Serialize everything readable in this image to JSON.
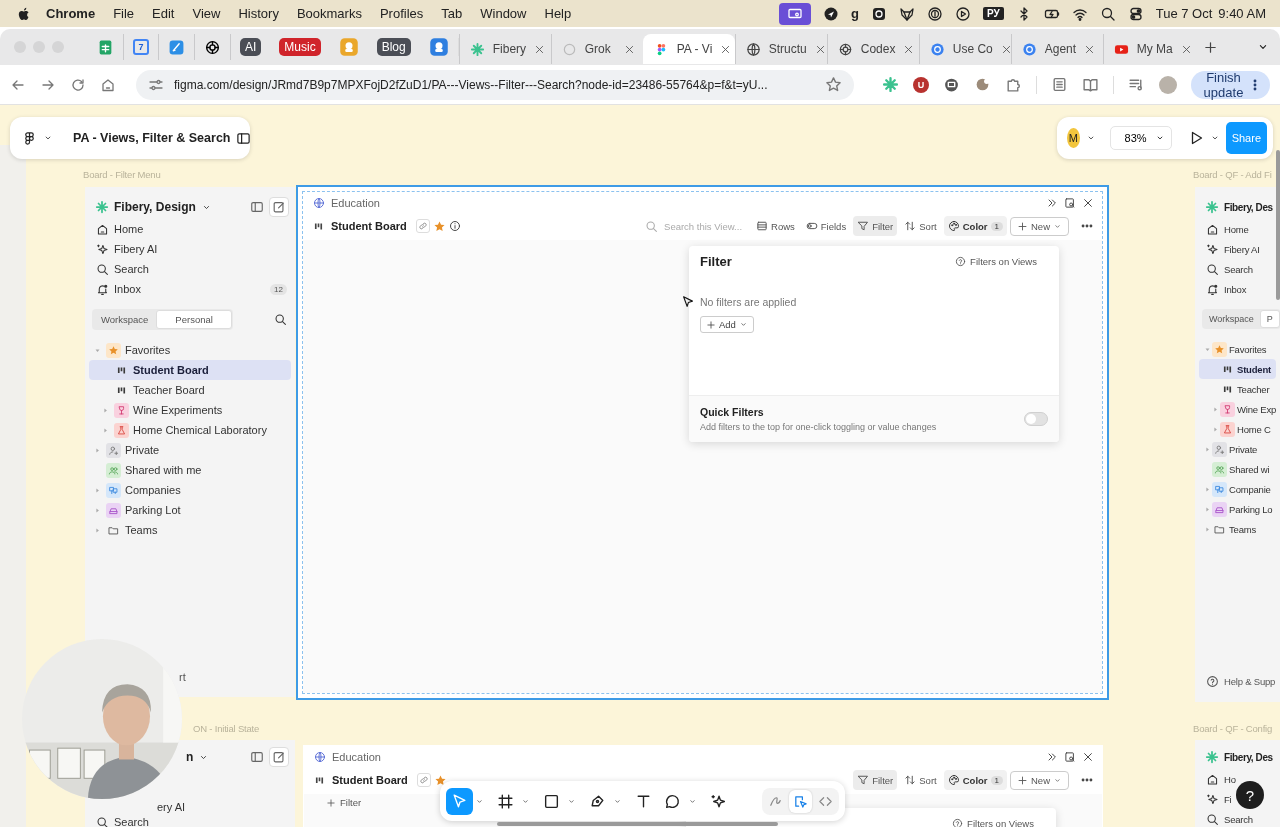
{
  "menubar": {
    "app": "Chrome",
    "menus": [
      "File",
      "Edit",
      "View",
      "History",
      "Bookmarks",
      "Profiles",
      "Tab",
      "Window",
      "Help"
    ],
    "status": [
      {
        "kind": "screen"
      },
      {
        "kind": "navigate"
      },
      {
        "kind": "letter",
        "label": "g"
      },
      {
        "kind": "gear"
      },
      {
        "kind": "fox"
      },
      {
        "kind": "key"
      },
      {
        "kind": "play"
      },
      {
        "kind": "letter",
        "label": "РУ"
      },
      {
        "kind": "bluetooth"
      },
      {
        "kind": "battery"
      },
      {
        "kind": "wifi"
      },
      {
        "kind": "search"
      },
      {
        "kind": "control"
      }
    ],
    "date": "Tue 7 Oct",
    "time": "9:40 AM"
  },
  "browser": {
    "pinned": [
      {
        "kind": "sheets"
      },
      {
        "kind": "calendar",
        "label": "7"
      },
      {
        "kind": "pen"
      },
      {
        "kind": "openai"
      },
      {
        "kind": "badge",
        "label": "AI",
        "color": "#4b4e56"
      },
      {
        "kind": "badge",
        "label": "Music",
        "color": "#d0242b"
      },
      {
        "kind": "app",
        "color": "#eaa72b"
      },
      {
        "kind": "badge",
        "label": "Blog",
        "color": "#4b4e56"
      },
      {
        "kind": "app",
        "color": "#2f7fe0"
      }
    ],
    "tabs": [
      {
        "kind": "fibery",
        "title": "Fibery",
        "selected": false
      },
      {
        "kind": "grok",
        "title": "Grok",
        "selected": false
      },
      {
        "kind": "figma",
        "title": "PA - Vi",
        "selected": true
      },
      {
        "kind": "globe",
        "title": "Structu",
        "selected": false
      },
      {
        "kind": "openai",
        "title": "Codex",
        "selected": false
      },
      {
        "kind": "blue",
        "title": "Use Co",
        "selected": false
      },
      {
        "kind": "blue",
        "title": "Agent",
        "selected": false
      },
      {
        "kind": "youtube",
        "title": "My Ma",
        "selected": false
      }
    ],
    "url": "figma.com/design/JRmd7B9p7MPXFojD2fZuD1/PA---Views--Filter---Search?node-id=23486-55764&p=f&t=yU...",
    "extensions": [
      {
        "kind": "fibery"
      },
      {
        "kind": "letter",
        "label": "U"
      },
      {
        "kind": "cat"
      },
      {
        "kind": "cookie"
      },
      {
        "kind": "puzzle"
      }
    ],
    "update_button": "Finish update"
  },
  "figma": {
    "file_name": "PA - Views, Filter & Search",
    "avatar": "M",
    "zoom": "83%",
    "share": "Share",
    "frames": [
      {
        "label": "Board - Filter Menu",
        "sidebar": {
          "workspace": {
            "kind": "full",
            "label": "Fibery, Design"
          },
          "nav": [
            {
              "kind": "home",
              "label": "Home"
            },
            {
              "kind": "ai",
              "label": "Fibery AI"
            },
            {
              "kind": "search",
              "label": "Search"
            },
            {
              "kind": "inbox",
              "label": "Inbox",
              "badge": "12"
            }
          ],
          "scope_tabs": [
            {
              "label": "Workspace",
              "selected": false
            },
            {
              "label": "Personal",
              "selected": true
            }
          ],
          "tree": [
            {
              "kind": "favorites",
              "label": "Favorites",
              "expanded": true,
              "selected": false,
              "children": [
                {
                  "kind": "board",
                  "label": "Student Board",
                  "selected": true
                },
                {
                  "kind": "board",
                  "label": "Teacher Board",
                  "selected": false
                },
                {
                  "kind": "wine",
                  "label": "Wine Experiments",
                  "expanded": false,
                  "selected": false
                },
                {
                  "kind": "lab",
                  "label": "Home Chemical Laboratory",
                  "expanded": false,
                  "selected": false
                }
              ]
            },
            {
              "kind": "private",
              "label": "Private",
              "expanded": false,
              "selected": false
            },
            {
              "kind": "shared",
              "label": "Shared with me",
              "selected": false
            },
            {
              "kind": "companies",
              "label": "Companies",
              "expanded": false,
              "selected": false
            },
            {
              "kind": "parking",
              "label": "Parking Lot",
              "expanded": false,
              "selected": false
            },
            {
              "kind": "folder",
              "label": "Teams",
              "expanded": false,
              "selected": false
            }
          ],
          "help": {
            "kind": "cut",
            "label": "rt"
          }
        },
        "view": {
          "selected": true,
          "space": "Education",
          "title": "Student Board",
          "favorite": true,
          "toolbar": [
            {
              "kind": "search",
              "placeholder": "Search this View..."
            },
            {
              "kind": "rows",
              "label": "Rows",
              "selected": false
            },
            {
              "kind": "fields",
              "label": "Fields",
              "selected": false
            },
            {
              "kind": "filter",
              "label": "Filter",
              "selected": true
            },
            {
              "kind": "sort",
              "label": "Sort",
              "selected": false
            },
            {
              "kind": "color",
              "label": "Color",
              "badge": "1"
            },
            {
              "kind": "new",
              "label": "New"
            },
            {
              "kind": "more"
            }
          ],
          "panel": {
            "title": "Filter",
            "help": "Filters on Views",
            "empty": "No filters are applied",
            "add": "Add",
            "quick_title": "Quick Filters",
            "quick_desc": "Add filters to the top for one-click toggling or value changes",
            "quick_on": false
          }
        }
      },
      {
        "label": "Board - QF - Add Fi",
        "sidebar": {
          "workspace": {
            "kind": "full",
            "label": "Fibery, Des"
          },
          "nav": [
            {
              "kind": "home",
              "label": "Home"
            },
            {
              "kind": "ai",
              "label": "Fibery AI"
            },
            {
              "kind": "search",
              "label": "Search"
            },
            {
              "kind": "inbox",
              "label": "Inbox"
            }
          ],
          "scope_tabs": [
            {
              "label": "Workspace",
              "selected": false
            },
            {
              "label": "P",
              "selected": true
            }
          ],
          "tree": [
            {
              "kind": "favorites",
              "label": "Favorites",
              "expanded": true,
              "selected": false,
              "children": [
                {
                  "kind": "board",
                  "label": "Student",
                  "selected": true
                },
                {
                  "kind": "board",
                  "label": "Teacher",
                  "selected": false
                },
                {
                  "kind": "wine",
                  "label": "Wine Exp",
                  "expanded": false,
                  "selected": false
                },
                {
                  "kind": "lab",
                  "label": "Home C",
                  "expanded": false,
                  "selected": false
                }
              ]
            },
            {
              "kind": "private",
              "label": "Private",
              "expanded": false,
              "selected": false
            },
            {
              "kind": "shared",
              "label": "Shared wi",
              "selected": false
            },
            {
              "kind": "companies",
              "label": "Companie",
              "expanded": false,
              "selected": false
            },
            {
              "kind": "parking",
              "label": "Parking Lo",
              "expanded": false,
              "selected": false
            },
            {
              "kind": "folder",
              "label": "Teams",
              "expanded": false,
              "selected": false
            }
          ],
          "help": {
            "kind": "help",
            "label": "Help & Supp"
          }
        }
      },
      {
        "label": "ON - Initial State",
        "sidebar": {
          "workspace": {
            "kind": "cut",
            "label": "n"
          },
          "nav": [
            {
              "kind": "cut",
              "label": "ery AI"
            },
            {
              "kind": "search",
              "label": "Search"
            }
          ]
        },
        "view": {
          "selected": false,
          "space": "Education",
          "title": "Student Board",
          "favorite": true,
          "toolbar": [
            {
              "kind": "filter",
              "label": "Filter",
              "selected": true
            },
            {
              "kind": "sort",
              "label": "Sort",
              "selected": false
            },
            {
              "kind": "color",
              "label": "Color",
              "badge": "1"
            },
            {
              "kind": "new",
              "label": "New"
            },
            {
              "kind": "more"
            }
          ],
          "quick_add": "Filter",
          "panel": {
            "help": "Filters on Views"
          }
        }
      },
      {
        "label": "Board - QF - Config",
        "sidebar": {
          "workspace": {
            "kind": "full",
            "label": "Fibery, Des"
          },
          "nav": [
            {
              "kind": "home",
              "label": "Ho"
            },
            {
              "kind": "ai",
              "label": "Fi"
            },
            {
              "kind": "search",
              "label": "Search"
            }
          ]
        }
      }
    ],
    "tools": [
      {
        "kind": "move",
        "selected": true,
        "menu": true
      },
      {
        "kind": "frame",
        "selected": false,
        "menu": true
      },
      {
        "kind": "rect",
        "selected": false,
        "menu": true
      },
      {
        "kind": "pen",
        "selected": false,
        "menu": true
      },
      {
        "kind": "text",
        "selected": false,
        "menu": false
      },
      {
        "kind": "comment",
        "selected": false,
        "menu": true
      },
      {
        "kind": "ai",
        "selected": false,
        "menu": false
      }
    ],
    "modes": [
      {
        "kind": "draw",
        "selected": false
      },
      {
        "kind": "design",
        "selected": true
      },
      {
        "kind": "dev",
        "selected": false
      }
    ],
    "help_button": "?"
  }
}
